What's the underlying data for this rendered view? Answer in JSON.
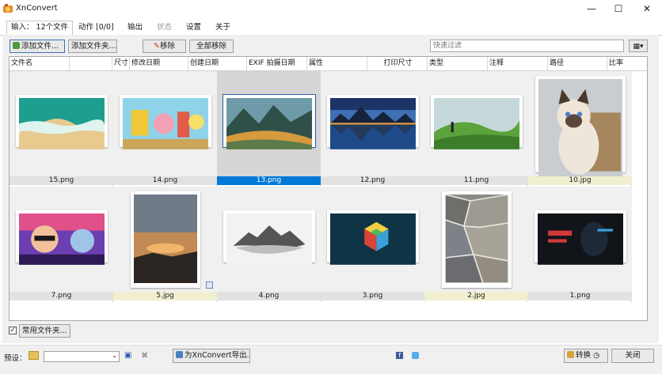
{
  "window": {
    "title": "XnConvert",
    "minimize": "—",
    "maximize": "☐",
    "close": "✕"
  },
  "tabs": [
    {
      "label": "输入： 12个文件"
    },
    {
      "label": "动作 [0/0]"
    },
    {
      "label": "输出"
    },
    {
      "label": "状态"
    },
    {
      "label": "设置"
    },
    {
      "label": "关于"
    }
  ],
  "toolbar": {
    "add_files": "添加文件...",
    "add_folder": "添加文件夹...",
    "remove": "移除",
    "remove_all": "全部移除",
    "filter_placeholder": "快速过滤"
  },
  "columns": [
    "文件名",
    "尺寸",
    "修改日期",
    "创建日期",
    "EXIF 拍摄日期",
    "属性",
    "打印尺寸",
    "类型",
    "注释",
    "路径",
    "比率"
  ],
  "files": [
    {
      "name": "15.png",
      "selected": false,
      "yellow": false,
      "icon": "beach-waves-image"
    },
    {
      "name": "14.png",
      "selected": false,
      "yellow": false,
      "icon": "cartoon-characters-image"
    },
    {
      "name": "13.png",
      "selected": true,
      "yellow": false,
      "icon": "mountain-valley-image"
    },
    {
      "name": "12.png",
      "selected": false,
      "yellow": false,
      "icon": "lake-reflection-image"
    },
    {
      "name": "11.png",
      "selected": false,
      "yellow": false,
      "icon": "green-hills-image"
    },
    {
      "name": "10.jpg",
      "selected": false,
      "yellow": true,
      "icon": "siamese-cat-image"
    },
    {
      "name": "7.png",
      "selected": false,
      "yellow": false,
      "icon": "cartoon-character-image"
    },
    {
      "name": "5.jpg",
      "selected": false,
      "yellow": true,
      "icon": "sunset-sky-image"
    },
    {
      "name": "4.png",
      "selected": false,
      "yellow": false,
      "icon": "misty-mountain-image"
    },
    {
      "name": "3.png",
      "selected": false,
      "yellow": false,
      "icon": "rubiks-cube-image"
    },
    {
      "name": "2.jpg",
      "selected": false,
      "yellow": true,
      "icon": "stone-pavement-image"
    },
    {
      "name": "1.png",
      "selected": false,
      "yellow": false,
      "icon": "hacker-data-image"
    }
  ],
  "common_folders": "常用文件夹...",
  "preset": {
    "label": "预设：",
    "value": ""
  },
  "export_button": "为XnConvert导出...",
  "convert_button": "转换",
  "close_button": "关闭",
  "colors": {
    "selection": "#0078d7",
    "panel": "#f0f0f0"
  }
}
